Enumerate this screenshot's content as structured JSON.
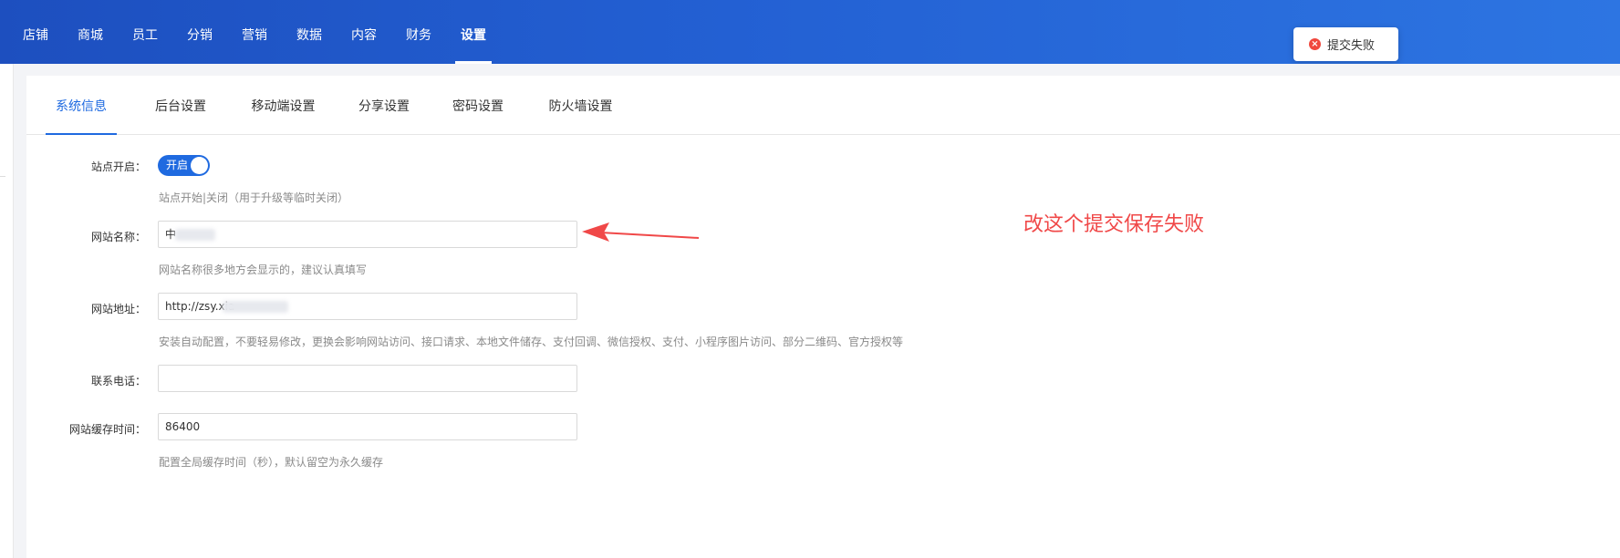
{
  "top_nav": {
    "items": [
      {
        "label": "店铺"
      },
      {
        "label": "商城"
      },
      {
        "label": "员工"
      },
      {
        "label": "分销"
      },
      {
        "label": "营销"
      },
      {
        "label": "数据"
      },
      {
        "label": "内容"
      },
      {
        "label": "财务"
      },
      {
        "label": "设置"
      }
    ],
    "active_index": 8
  },
  "toast": {
    "text": "提交失败",
    "type": "error"
  },
  "tabs": [
    {
      "label": "系统信息"
    },
    {
      "label": "后台设置"
    },
    {
      "label": "移动端设置"
    },
    {
      "label": "分享设置"
    },
    {
      "label": "密码设置"
    },
    {
      "label": "防火墙设置"
    }
  ],
  "form": {
    "site_open": {
      "label": "站点开启：",
      "switch_text": "开启",
      "enabled": true,
      "help": "站点开始|关闭（用于升级等临时关闭）"
    },
    "site_name": {
      "label": "网站名称：",
      "value": "中",
      "help": "网站名称很多地方会显示的，建议认真填写"
    },
    "site_url": {
      "label": "网站地址：",
      "value": "http://zsy.xia",
      "help": "安装自动配置，不要轻易修改，更换会影响网站访问、接口请求、本地文件储存、支付回调、微信授权、支付、小程序图片访问、部分二维码、官方授权等"
    },
    "contact_phone": {
      "label": "联系电话：",
      "value": ""
    },
    "cache_time": {
      "label": "网站缓存时间：",
      "value": "86400",
      "help": "配置全局缓存时间（秒），默认留空为永久缓存"
    }
  },
  "annotation": {
    "text": "改这个提交保存失败",
    "color": "#f04848"
  },
  "colors": {
    "accent": "#1f6ae0",
    "topbar_start": "#1d4fbf",
    "topbar_end": "#2d75e2",
    "error": "#f0483e"
  }
}
